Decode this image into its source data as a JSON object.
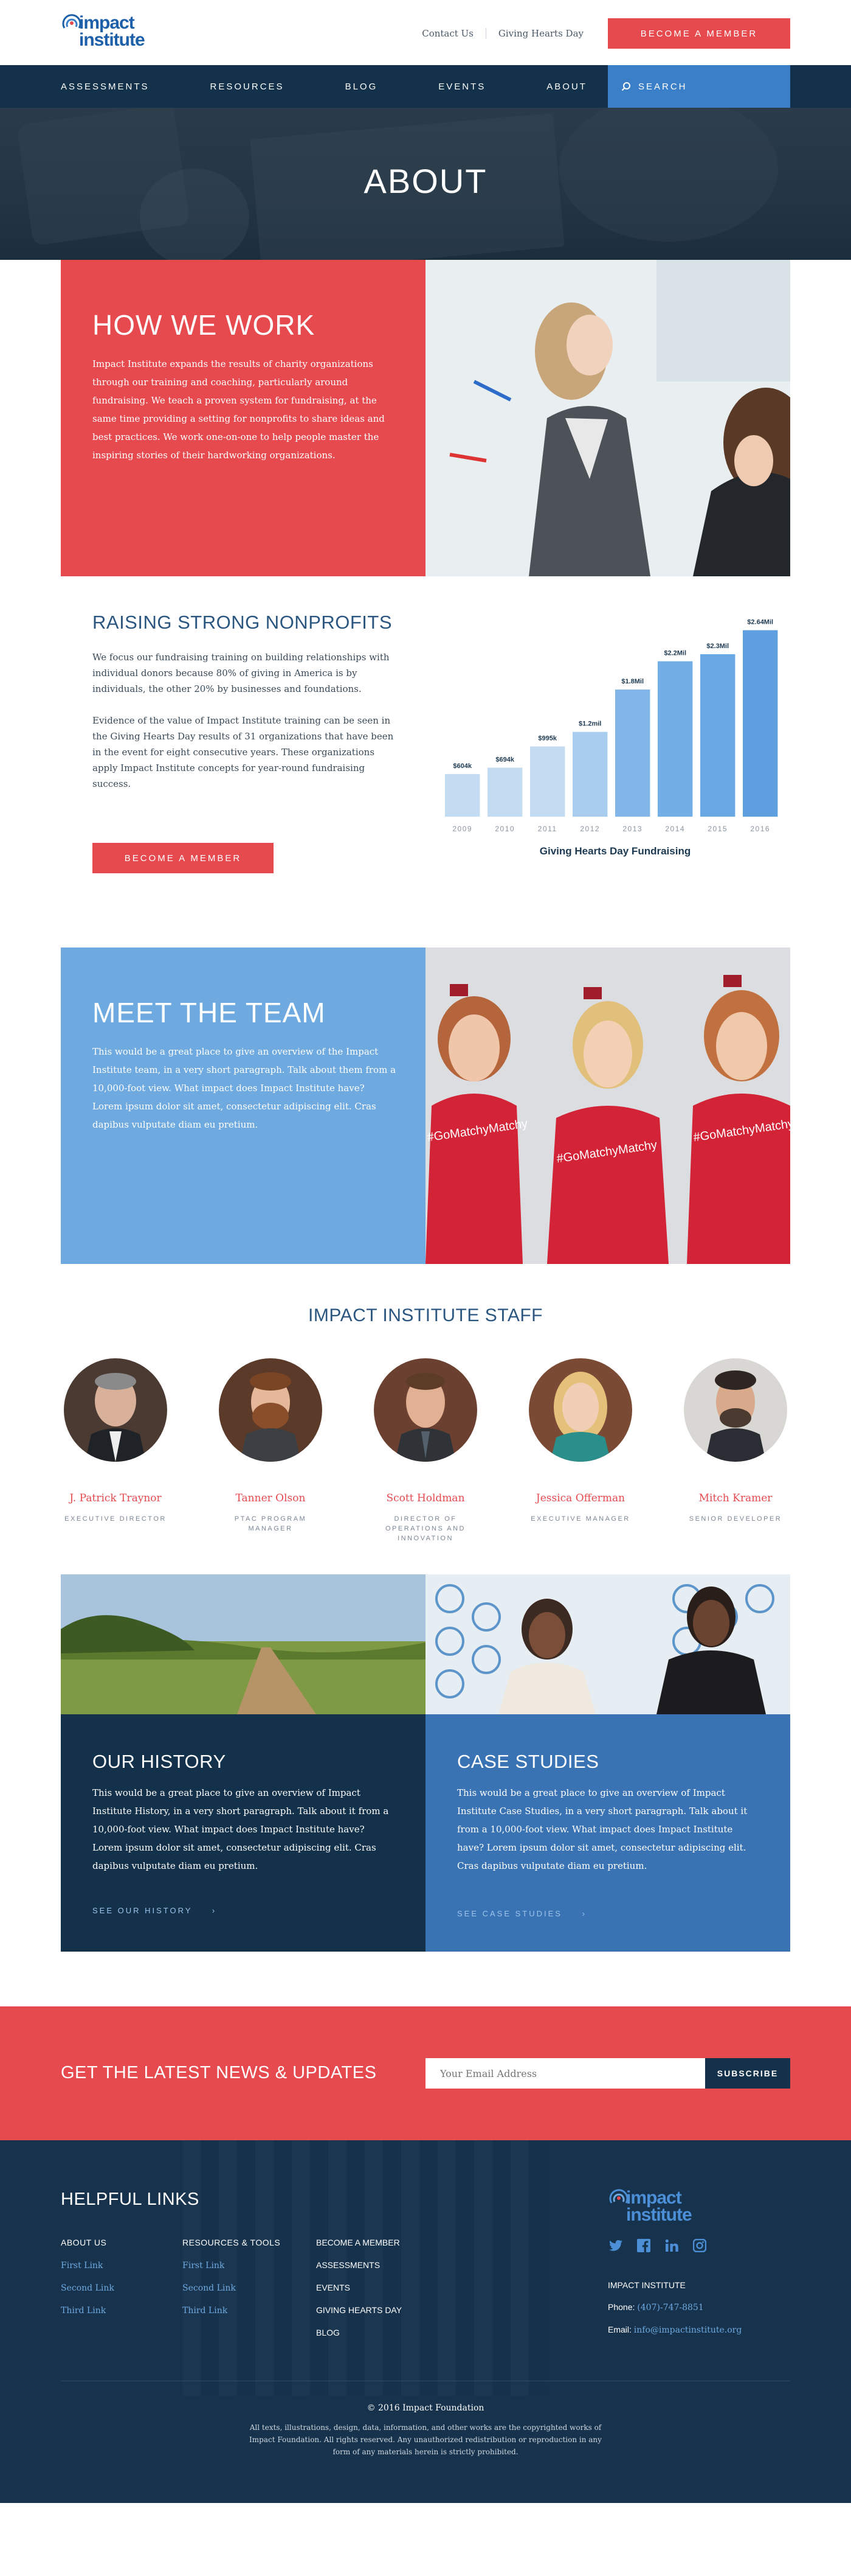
{
  "brand": {
    "logo_line1": "impact",
    "logo_line2": "institute"
  },
  "header": {
    "top_links": [
      "Contact Us",
      "Giving Hearts Day"
    ],
    "cta": "BECOME A MEMBER",
    "nav": [
      "ASSESSMENTS",
      "RESOURCES",
      "BLOG",
      "EVENTS",
      "ABOUT"
    ],
    "search_label": "SEARCH"
  },
  "hero": {
    "title": "ABOUT"
  },
  "how_we_work": {
    "title": "HOW WE WORK",
    "text": "Impact Institute expands the results of charity organizations through our training and coaching, particularly around fundraising. We teach a proven system for fundraising, at the same time providing a setting for nonprofits to share ideas and best practices. We work one-on-one to help people master the inspiring stories of their hardworking organizations."
  },
  "raising": {
    "title": "RAISING STRONG NONPROFITS",
    "para1": "We focus our fundraising training on building relationships with individual donors because 80% of giving in America is by individuals, the other 20% by businesses and foundations.",
    "para2": "Evidence of the value of Impact Institute training can be seen in the Giving Hearts Day results of 31 organizations that have been in the event for eight consecutive years. These organizations apply Impact Institute concepts for year-round fundraising success.",
    "button": "BECOME A MEMBER"
  },
  "chart_data": {
    "type": "bar",
    "title": "Giving Hearts Day Fundraising",
    "categories": [
      "2009",
      "2010",
      "2011",
      "2012",
      "2013",
      "2014",
      "2015",
      "2016"
    ],
    "values": [
      0.604,
      0.694,
      0.995,
      1.2,
      1.8,
      2.2,
      2.3,
      2.64
    ],
    "data_labels": [
      "$604k",
      "$694k",
      "$995k",
      "$1.2mil",
      "$1.8Mil",
      "$2.2Mil",
      "$2.3Mil",
      "$2.64Mil"
    ],
    "value_unit": "$ millions",
    "ylim": [
      0,
      2.8
    ],
    "grid": false,
    "colors": [
      "#c4dcf1",
      "#c4dcf1",
      "#c4dcf1",
      "#a9cdee",
      "#82b6e8",
      "#74aee6",
      "#6aa8e4",
      "#5e9fe0"
    ]
  },
  "team": {
    "title": "MEET THE TEAM",
    "text": "This would be a great place to give an overview of  the Impact Institute team, in a very short paragraph. Talk about them from a 10,000-foot view. What impact does Impact Institute have? Lorem ipsum dolor sit amet, consectetur adipiscing elit. Cras dapibus vulputate diam eu pretium.",
    "shirt_text": "#GoMatchyMatchy"
  },
  "staff": {
    "title": "IMPACT INSTITUTE STAFF",
    "members": [
      {
        "name": "J. Patrick Traynor",
        "role": "EXECUTIVE DIRECTOR"
      },
      {
        "name": "Tanner Olson",
        "role": "PTAC PROGRAM MANAGER"
      },
      {
        "name": "Scott Holdman",
        "role": "DIRECTOR OF OPERATIONS AND INNOVATION"
      },
      {
        "name": "Jessica Offerman",
        "role": "EXECUTIVE MANAGER"
      },
      {
        "name": "Mitch Kramer",
        "role": "SENIOR DEVELOPER"
      }
    ]
  },
  "history": {
    "title": "OUR HISTORY",
    "text": "This would be a great place to give an overview of Impact Institute History, in a very short paragraph. Talk about it from a 10,000-foot view. What impact does Impact Institute have? Lorem ipsum dolor sit amet, consectetur adipiscing elit. Cras dapibus vulputate diam eu pretium.",
    "link": "SEE OUR HISTORY"
  },
  "case_studies": {
    "title": "CASE STUDIES",
    "text": "This would be a great place to give an overview of Impact Institute Case Studies, in a very short paragraph. Talk about it from a 10,000-foot view. What impact does Impact Institute have? Lorem ipsum dolor sit amet, consectetur adipiscing elit. Cras dapibus vulputate diam eu pretium.",
    "link": "SEE CASE STUDIES"
  },
  "newsletter": {
    "title": "GET THE LATEST NEWS & UPDATES",
    "placeholder": "Your Email Address",
    "button": "SUBSCRIBE"
  },
  "footer": {
    "title": "HELPFUL LINKS",
    "col1": {
      "head": "ABOUT US",
      "links": [
        "First Link",
        "Second Link",
        "Third Link"
      ]
    },
    "col2": {
      "head": "RESOURCES & TOOLS",
      "links": [
        "First Link",
        "Second Link",
        "Third Link"
      ]
    },
    "col3": [
      "BECOME A MEMBER",
      "ASSESSMENTS",
      "EVENTS",
      "GIVING HEARTS DAY",
      "BLOG"
    ],
    "org_name": "IMPACT INSTITUTE",
    "phone_label": "Phone:",
    "phone": "(407)-747-8851",
    "email_label": "Email:",
    "email": "info@impactinstitute.org",
    "social_icons": [
      "twitter-icon",
      "facebook-icon",
      "linkedin-icon",
      "instagram-icon"
    ],
    "copyright": "© 2016 Impact Foundation",
    "legal": "All texts, illustrations, design, data, information, and other works are the copyrighted works of Impact Foundation. All rights reserved. Any unauthorized redistribution or reproduction in any form of any materials herein is strictly prohibited."
  },
  "colors": {
    "red": "#e6494e",
    "navy": "#13314a",
    "blue": "#3a7fc7",
    "light_blue": "#6ea9e0"
  }
}
